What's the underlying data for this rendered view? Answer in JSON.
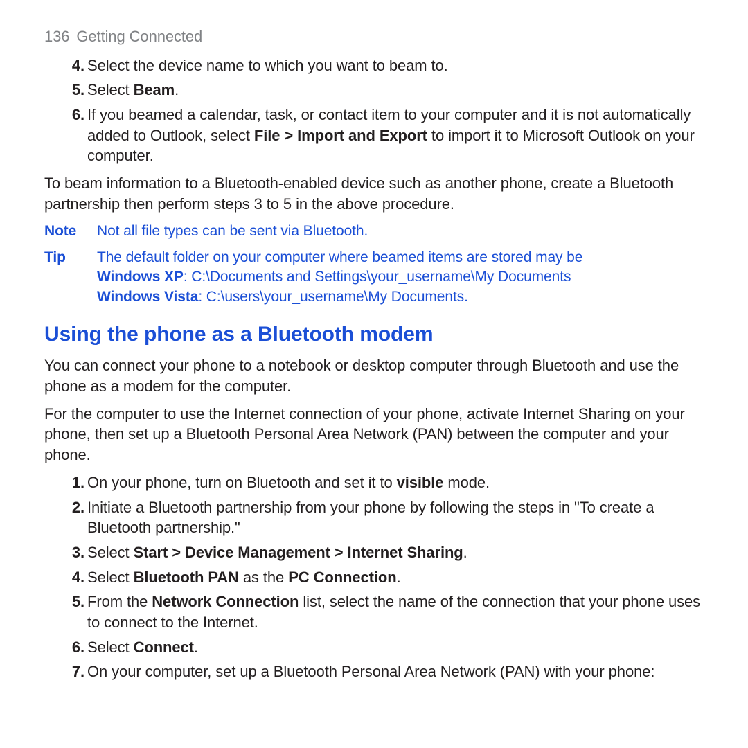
{
  "header": {
    "page_number": "136",
    "section": "Getting Connected"
  },
  "list1": {
    "item4": {
      "num": "4.",
      "text": "Select the device name to which you want to beam to."
    },
    "item5": {
      "num": "5.",
      "pre": "Select ",
      "bold": "Beam",
      "post": "."
    },
    "item6": {
      "num": "6.",
      "pre": "If you beamed a calendar, task, or contact item to your computer and it is not automatically added to Outlook, select ",
      "bold": "File > Import and Export",
      "post": " to import it to Microsoft Outlook on your computer."
    }
  },
  "para1": "To beam information to a Bluetooth-enabled device such as another phone, create a Bluetooth partnership then perform steps 3 to 5 in the above procedure.",
  "note": {
    "label": "Note",
    "text": "Not all file types can be sent via Bluetooth."
  },
  "tip": {
    "label": "Tip",
    "line1": "The default folder on your computer where beamed items are stored may be",
    "xp_label": "Windows XP",
    "xp_path": ": C:\\Documents and Settings\\your_username\\My Documents",
    "vista_label": "Windows Vista",
    "vista_path": ": C:\\users\\your_username\\My Documents."
  },
  "heading": "Using the phone as a Bluetooth modem",
  "para2": "You can connect your phone to a notebook or desktop computer through Bluetooth and use the phone as a modem for the computer.",
  "para3": "For the computer to use the Internet connection of your phone, activate Internet Sharing on your phone, then set up a Bluetooth Personal Area Network (PAN) between the computer and your phone.",
  "list2": {
    "item1": {
      "num": "1.",
      "pre": "On your phone, turn on Bluetooth and set it to ",
      "bold": "visible",
      "post": " mode."
    },
    "item2": {
      "num": "2.",
      "text": "Initiate a Bluetooth partnership from your phone by following the steps in \"To create a Bluetooth partnership.\""
    },
    "item3": {
      "num": "3.",
      "pre": "Select ",
      "bold": "Start > Device Management > Internet Sharing",
      "post": "."
    },
    "item4": {
      "num": "4.",
      "pre": "Select ",
      "bold1": "Bluetooth PAN",
      "mid": " as the ",
      "bold2": "PC Connection",
      "post": "."
    },
    "item5": {
      "num": "5.",
      "pre": "From the ",
      "bold": "Network Connection",
      "post": " list, select the name of the connection that your phone uses to connect to the Internet."
    },
    "item6": {
      "num": "6.",
      "pre": "Select ",
      "bold": "Connect",
      "post": "."
    },
    "item7": {
      "num": "7.",
      "text": "On your computer, set up a Bluetooth Personal Area Network (PAN) with your phone:"
    }
  }
}
